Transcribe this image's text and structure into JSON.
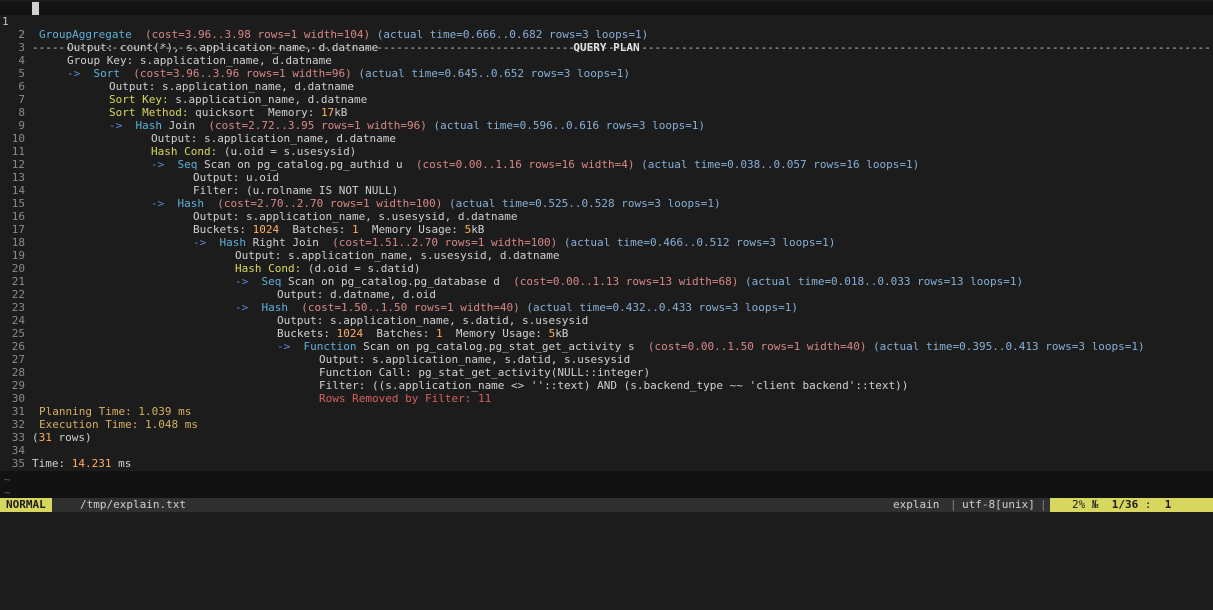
{
  "window": {
    "header_title": "QUERY PLAN",
    "line1_number": "1",
    "separator": "----------------------------------------------------------------------------------------------------------------------------------------------------------------------------------"
  },
  "colors": {
    "background": "#1c1c1c",
    "cost": "#d78787",
    "actual": "#87afd7",
    "key": "#d7d75f",
    "number": "#ffaf5f",
    "node": "#5fafd7",
    "removed": "#d75f5f",
    "mode_bg": "#d7d75f"
  },
  "lines": [
    {
      "n": "2",
      "indent": 1,
      "parts": [
        [
          "node",
          "GroupAggregate"
        ],
        [
          "plain",
          "  "
        ],
        [
          "cost",
          "(cost=3.96..3.98 rows=1 width=104)"
        ],
        [
          "plain",
          " "
        ],
        [
          "actual",
          "(actual time=0.666..0.682 rows=3 loops=1)"
        ]
      ]
    },
    {
      "n": "3",
      "indent": 5,
      "parts": [
        [
          "plain",
          "Output: count(*), s.application_name, d.datname"
        ]
      ]
    },
    {
      "n": "4",
      "indent": 5,
      "parts": [
        [
          "plain",
          "Group Key: s.application_name, d.datname"
        ]
      ]
    },
    {
      "n": "5",
      "indent": 5,
      "parts": [
        [
          "arrow",
          "->  "
        ],
        [
          "node",
          "Sort"
        ],
        [
          "plain",
          "  "
        ],
        [
          "cost",
          "(cost=3.96..3.96 rows=1 width=96)"
        ],
        [
          "plain",
          " "
        ],
        [
          "actual",
          "(actual time=0.645..0.652 rows=3 loops=1)"
        ]
      ]
    },
    {
      "n": "6",
      "indent": 11,
      "parts": [
        [
          "plain",
          "Output: s.application_name, d.datname"
        ]
      ]
    },
    {
      "n": "7",
      "indent": 11,
      "parts": [
        [
          "key",
          "Sort Key:"
        ],
        [
          "plain",
          " s.application_name, d.datname"
        ]
      ]
    },
    {
      "n": "8",
      "indent": 11,
      "parts": [
        [
          "key",
          "Sort Method:"
        ],
        [
          "plain",
          " quicksort  Memory: "
        ],
        [
          "num",
          "17"
        ],
        [
          "plain",
          "kB"
        ]
      ]
    },
    {
      "n": "9",
      "indent": 11,
      "parts": [
        [
          "arrow",
          "->  "
        ],
        [
          "node",
          "Hash"
        ],
        [
          "plain",
          " Join  "
        ],
        [
          "cost",
          "(cost=2.72..3.95 rows=1 width=96)"
        ],
        [
          "plain",
          " "
        ],
        [
          "actual",
          "(actual time=0.596..0.616 rows=3 loops=1)"
        ]
      ]
    },
    {
      "n": "10",
      "indent": 17,
      "parts": [
        [
          "plain",
          "Output: s.application_name, d.datname"
        ]
      ]
    },
    {
      "n": "11",
      "indent": 17,
      "parts": [
        [
          "key",
          "Hash Cond:"
        ],
        [
          "plain",
          " (u.oid = s.usesysid)"
        ]
      ]
    },
    {
      "n": "12",
      "indent": 17,
      "parts": [
        [
          "arrow",
          "->  "
        ],
        [
          "node",
          "Seq"
        ],
        [
          "plain",
          " Scan on pg_catalog.pg_authid u  "
        ],
        [
          "cost",
          "(cost=0.00..1.16 rows=16 width=4)"
        ],
        [
          "plain",
          " "
        ],
        [
          "actual",
          "(actual time=0.038..0.057 rows=16 loops=1)"
        ]
      ]
    },
    {
      "n": "13",
      "indent": 23,
      "parts": [
        [
          "plain",
          "Output: u.oid"
        ]
      ]
    },
    {
      "n": "14",
      "indent": 23,
      "parts": [
        [
          "plain",
          "Filter: (u.rolname IS NOT NULL)"
        ]
      ]
    },
    {
      "n": "15",
      "indent": 17,
      "parts": [
        [
          "arrow",
          "->  "
        ],
        [
          "node",
          "Hash"
        ],
        [
          "plain",
          "  "
        ],
        [
          "cost",
          "(cost=2.70..2.70 rows=1 width=100)"
        ],
        [
          "plain",
          " "
        ],
        [
          "actual",
          "(actual time=0.525..0.528 rows=3 loops=1)"
        ]
      ]
    },
    {
      "n": "16",
      "indent": 23,
      "parts": [
        [
          "plain",
          "Output: s.application_name, s.usesysid, d.datname"
        ]
      ]
    },
    {
      "n": "17",
      "indent": 23,
      "parts": [
        [
          "plain",
          "Buckets: "
        ],
        [
          "num",
          "1024"
        ],
        [
          "plain",
          "  Batches: "
        ],
        [
          "num",
          "1"
        ],
        [
          "plain",
          "  Memory Usage: "
        ],
        [
          "num",
          "5"
        ],
        [
          "plain",
          "kB"
        ]
      ]
    },
    {
      "n": "18",
      "indent": 23,
      "parts": [
        [
          "arrow",
          "->  "
        ],
        [
          "node",
          "Hash"
        ],
        [
          "plain",
          " Right Join  "
        ],
        [
          "cost",
          "(cost=1.51..2.70 rows=1 width=100)"
        ],
        [
          "plain",
          " "
        ],
        [
          "actual",
          "(actual time=0.466..0.512 rows=3 loops=1)"
        ]
      ]
    },
    {
      "n": "19",
      "indent": 29,
      "parts": [
        [
          "plain",
          "Output: s.application_name, s.usesysid, d.datname"
        ]
      ]
    },
    {
      "n": "20",
      "indent": 29,
      "parts": [
        [
          "key",
          "Hash Cond:"
        ],
        [
          "plain",
          " (d.oid = s.datid)"
        ]
      ]
    },
    {
      "n": "21",
      "indent": 29,
      "parts": [
        [
          "arrow",
          "->  "
        ],
        [
          "node",
          "Seq"
        ],
        [
          "plain",
          " Scan on pg_catalog.pg_database d  "
        ],
        [
          "cost",
          "(cost=0.00..1.13 rows=13 width=68)"
        ],
        [
          "plain",
          " "
        ],
        [
          "actual",
          "(actual time=0.018..0.033 rows=13 loops=1)"
        ]
      ]
    },
    {
      "n": "22",
      "indent": 35,
      "parts": [
        [
          "plain",
          "Output: d.datname, d.oid"
        ]
      ]
    },
    {
      "n": "23",
      "indent": 29,
      "parts": [
        [
          "arrow",
          "->  "
        ],
        [
          "node",
          "Hash"
        ],
        [
          "plain",
          "  "
        ],
        [
          "cost",
          "(cost=1.50..1.50 rows=1 width=40)"
        ],
        [
          "plain",
          " "
        ],
        [
          "actual",
          "(actual time=0.432..0.433 rows=3 loops=1)"
        ]
      ]
    },
    {
      "n": "24",
      "indent": 35,
      "parts": [
        [
          "plain",
          "Output: s.application_name, s.datid, s.usesysid"
        ]
      ]
    },
    {
      "n": "25",
      "indent": 35,
      "parts": [
        [
          "plain",
          "Buckets: "
        ],
        [
          "num",
          "1024"
        ],
        [
          "plain",
          "  Batches: "
        ],
        [
          "num",
          "1"
        ],
        [
          "plain",
          "  Memory Usage: "
        ],
        [
          "num",
          "5"
        ],
        [
          "plain",
          "kB"
        ]
      ]
    },
    {
      "n": "26",
      "indent": 35,
      "parts": [
        [
          "arrow",
          "->  "
        ],
        [
          "node",
          "Function"
        ],
        [
          "plain",
          " Scan on pg_catalog.pg_stat_get_activity s  "
        ],
        [
          "cost",
          "(cost=0.00..1.50 rows=1 width=40)"
        ],
        [
          "plain",
          " "
        ],
        [
          "actual",
          "(actual time=0.395..0.413 rows=3 loops=1)"
        ]
      ]
    },
    {
      "n": "27",
      "indent": 41,
      "parts": [
        [
          "plain",
          "Output: s.application_name, s.datid, s.usesysid"
        ]
      ]
    },
    {
      "n": "28",
      "indent": 41,
      "parts": [
        [
          "plain",
          "Function Call: pg_stat_get_activity(NULL::integer)"
        ]
      ]
    },
    {
      "n": "29",
      "indent": 41,
      "parts": [
        [
          "plain",
          "Filter: ((s.application_name <> ''::text) AND (s.backend_type ~~ 'client backend'::text))"
        ]
      ]
    },
    {
      "n": "30",
      "indent": 41,
      "parts": [
        [
          "removed",
          "Rows Removed by Filter: 11"
        ]
      ]
    },
    {
      "n": "31",
      "indent": 1,
      "parts": [
        [
          "time",
          "Planning Time: 1.039 ms"
        ]
      ]
    },
    {
      "n": "32",
      "indent": 1,
      "parts": [
        [
          "time",
          "Execution Time: 1.048 ms"
        ]
      ]
    },
    {
      "n": "33",
      "indent": 0,
      "parts": [
        [
          "plain",
          "("
        ],
        [
          "num",
          "31"
        ],
        [
          "plain",
          " rows)"
        ]
      ]
    },
    {
      "n": "34",
      "indent": 0,
      "parts": []
    },
    {
      "n": "35",
      "indent": 0,
      "parts": [
        [
          "plain",
          "Time: "
        ],
        [
          "num",
          "14.231"
        ],
        [
          "plain",
          " ms"
        ]
      ]
    }
  ],
  "tildes": [
    "~",
    "~"
  ],
  "statusbar": {
    "mode": "NORMAL",
    "filename": "/tmp/explain.txt",
    "filetype": "explain",
    "encoding": "utf-8[unix]",
    "percent": "2%",
    "line_symbol": "№",
    "position": "1/36",
    "column": "1"
  }
}
